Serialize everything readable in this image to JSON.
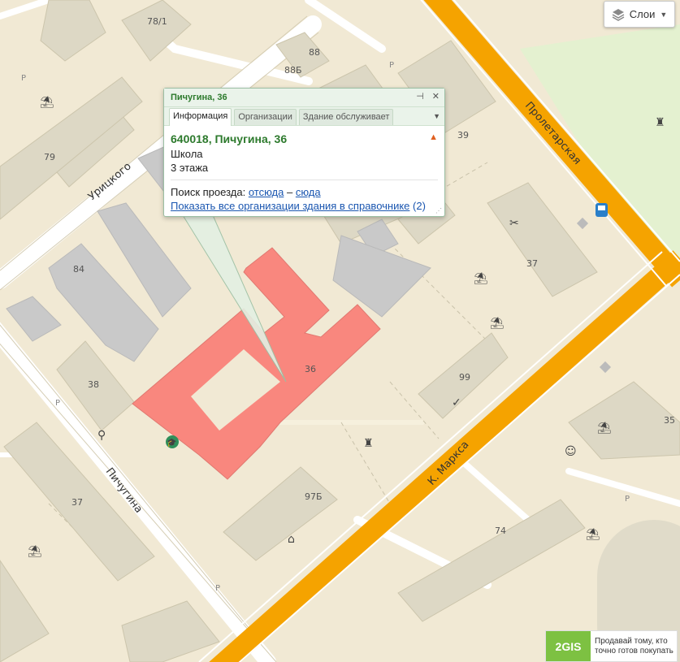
{
  "map": {
    "streets": {
      "proletarskaya": "Пролетарская",
      "uritskogo": "Урицкого",
      "pichugina": "Пичугина",
      "k_marksa": "К. Маркса"
    },
    "house_numbers": {
      "h78_1": "78/1",
      "h88": "88",
      "h88b": "88Б",
      "h79": "79",
      "h39": "39",
      "h84": "84",
      "h37_right": "37",
      "h36": "36",
      "h38": "38",
      "h99": "99",
      "h35": "35",
      "h97b": "97Б",
      "h37_left": "37",
      "h74": "74"
    },
    "parking_label": "P"
  },
  "layers": {
    "label": "Слои",
    "icon": "layers-icon"
  },
  "popup": {
    "title": "Пичугина, 36",
    "tabs": [
      "Информация",
      "Организации",
      "Здание обслуживает"
    ],
    "address": "640018, Пичугина, 36",
    "type": "Школа",
    "floors": "3 этажа",
    "route_label": "Поиск проезда:",
    "route_from": "отсюда",
    "route_dash": "–",
    "route_to": "сюда",
    "show_all": "Показать все организации здания в справочнике",
    "show_all_count": "(2)"
  },
  "ad": {
    "logo": "2GIS",
    "line1": "Продавай тому, кто",
    "line2": "точно готов покупать"
  },
  "colors": {
    "background": "#f1e9d4",
    "main_road": "#f5a300",
    "selected_building": "#f9877e",
    "building": "#ddd8c5",
    "grey_building": "#c9c9c9",
    "park": "#e4f1d0"
  }
}
